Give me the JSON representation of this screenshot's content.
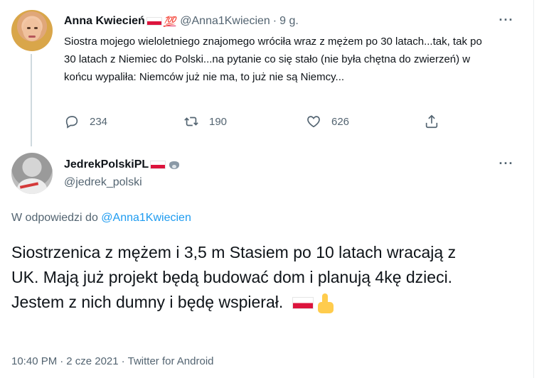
{
  "parent": {
    "name": "Anna Kwiecień",
    "badge_text": "💯",
    "handle": "@Anna1Kwiecien",
    "separator": "·",
    "time": "9 g.",
    "text": "Siostra mojego wieloletniego znajomego wróciła wraz z mężem po 30 latach...tak, tak po 30 latach z Niemiec do  Polski...na pytanie co się stało (nie była chętna do zwierzeń) w końcu wypaliła: Niemców już nie ma, to już nie są Niemcy...",
    "stats": {
      "replies": "234",
      "retweets": "190",
      "likes": "626"
    }
  },
  "reply": {
    "name": "JedrekPolskiPL",
    "handle": "@jedrek_polski",
    "in_reply_prefix": "W odpowiedzi do ",
    "in_reply_handle": "@Anna1Kwiecien",
    "text": "Siostrzenica z mężem i 3,5 m Stasiem po 10 latach wracają z UK. Mają już projekt będą budować dom i planują 4kę dzieci. Jestem z nich dumny i będę wspierał.",
    "time": "10:40 PM",
    "date": "2 cze 2021",
    "source": "Twitter for Android",
    "separator": "·"
  },
  "menu_glyph": "···",
  "icons": {
    "reply": "reply-icon",
    "retweet": "retweet-icon",
    "like": "heart-icon",
    "share": "share-icon",
    "more": "more-icon",
    "flag": "poland-flag-icon",
    "wolf": "wolf-icon",
    "thumbs_up": "thumbs-up-icon"
  },
  "colors": {
    "text": "#0f1419",
    "secondary": "#536471",
    "link": "#1d9bf0",
    "flag_red": "#dc143c",
    "hundred": "#e0245e"
  }
}
